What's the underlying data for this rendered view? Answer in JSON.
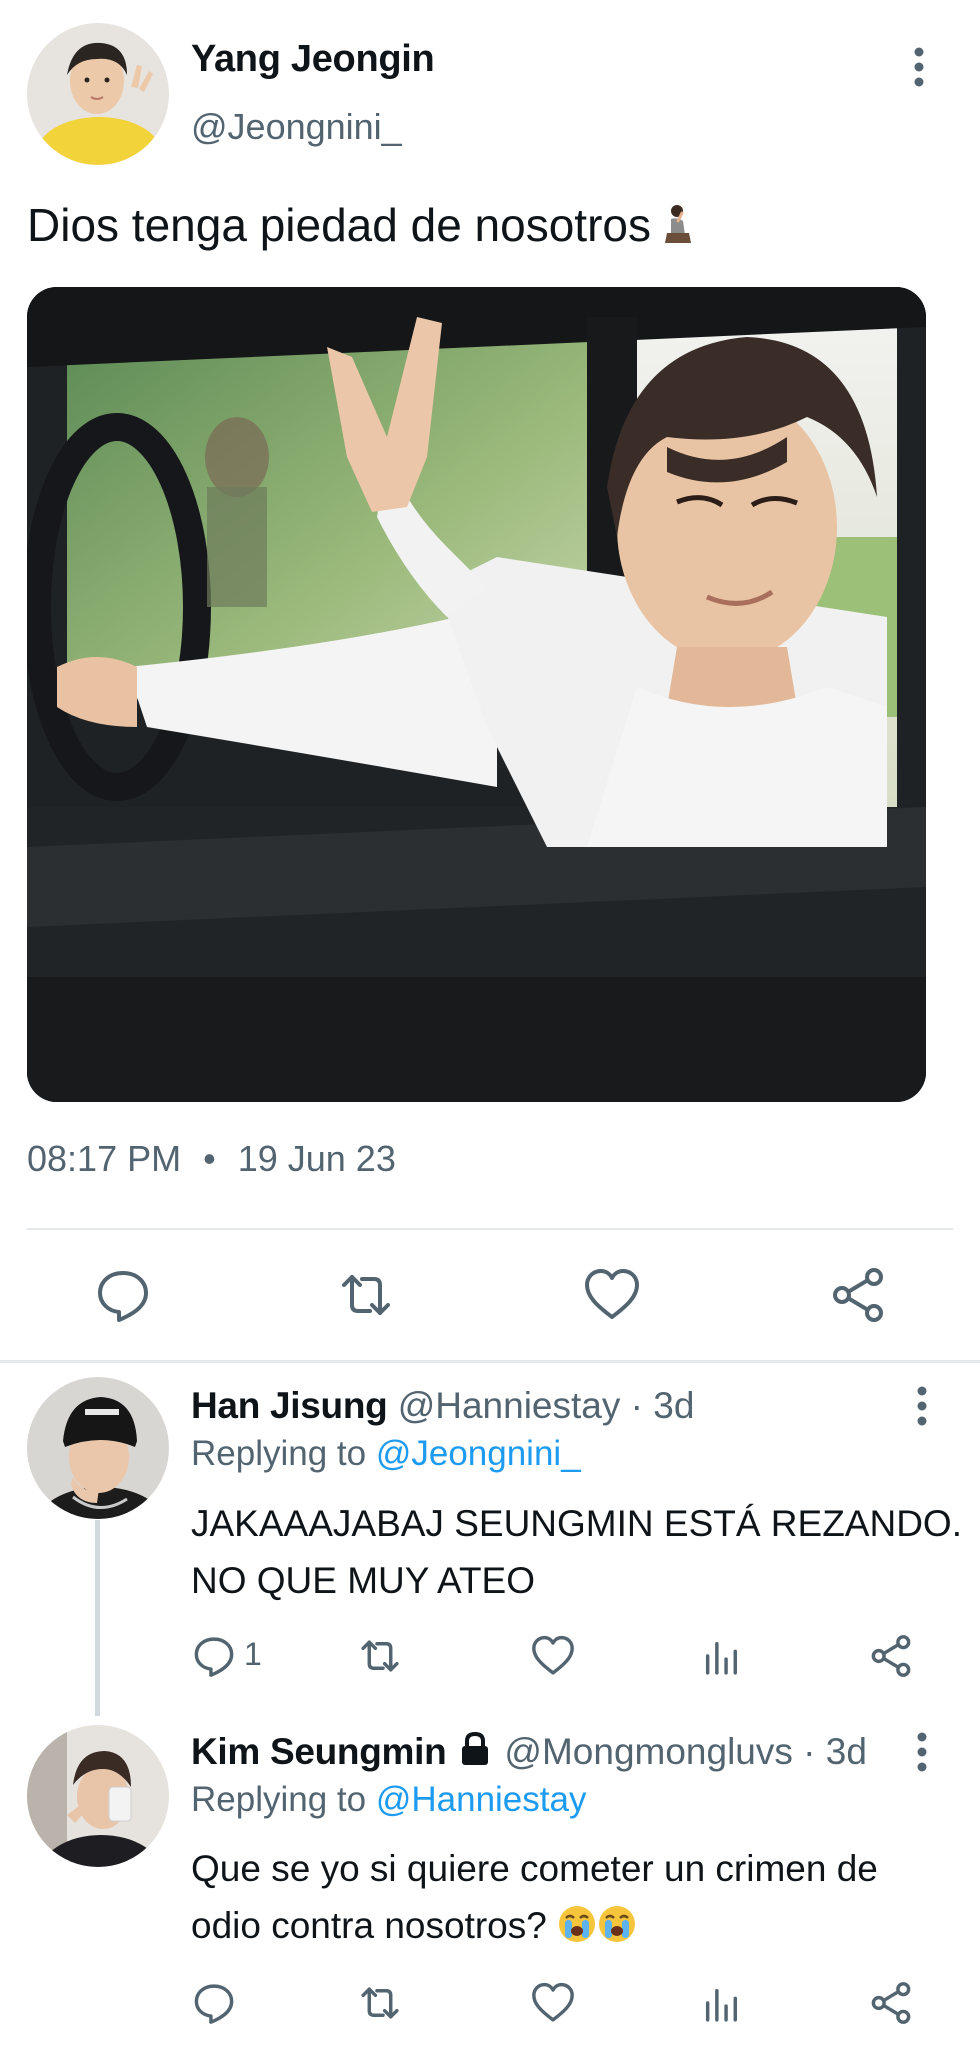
{
  "main_tweet": {
    "author_name": "Yang Jeongin",
    "author_handle": "@Jeongnini_",
    "text": "Dios tenga piedad de nosotros",
    "text_emoji": "praying-person-emoji",
    "time": "08:17 PM",
    "separator": "•",
    "date": "19 Jun 23",
    "media_description": "photo-of-person-in-car-making-peace-sign"
  },
  "replies": [
    {
      "author_name": "Han Jisung",
      "author_handle": "@Hanniestay",
      "age": "· 3d",
      "replying_prefix": "Replying to ",
      "replying_to": "@Jeongnini_",
      "text_line1": "JAKAAAJABAJ SEUNGMIN ESTÁ REZANDO.",
      "text_line2": "NO QUE MUY ATEO",
      "reply_count": "1"
    },
    {
      "author_name": "Kim Seungmin",
      "author_handle": "@Mongmongluvs",
      "age": "· 3d",
      "protected_icon": "lock-icon",
      "replying_prefix": "Replying to ",
      "replying_to": "@Hanniestay",
      "text_line1": "Que se yo si quiere cometer un crimen de",
      "text_line2": "odio contra nosotros?",
      "text_emoji": "loudly-crying-face-emoji"
    }
  ],
  "colors": {
    "text_primary": "#0f1419",
    "text_secondary": "#536471",
    "link": "#1d9bf0",
    "icon": "#536471",
    "divider": "#e6e9eb"
  }
}
